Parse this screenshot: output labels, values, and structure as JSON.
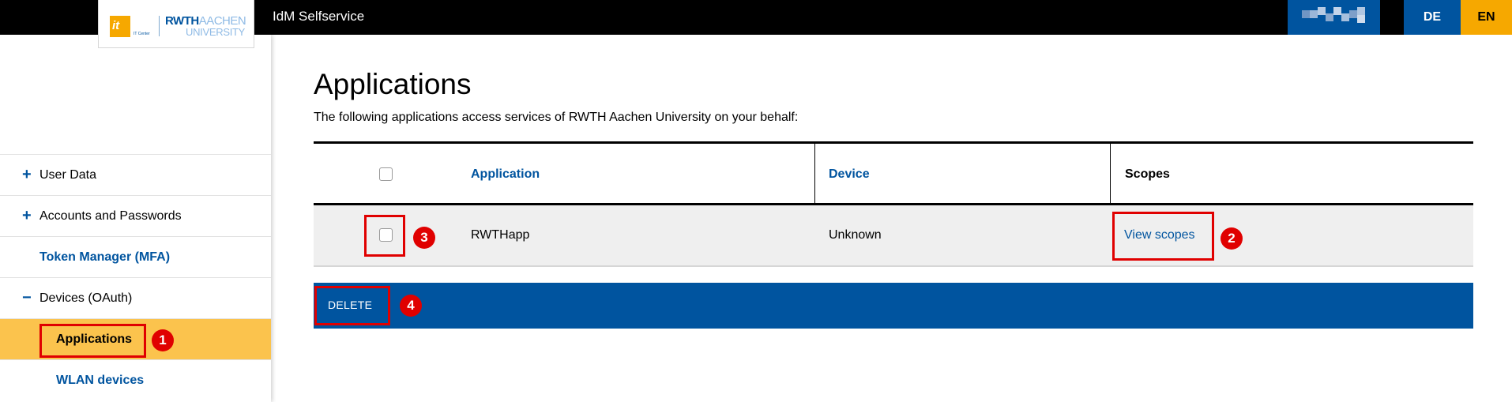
{
  "header": {
    "logo": {
      "itc_letters": "it",
      "itc_caption": "IT Center",
      "rwth_bold": "RWTH",
      "rwth_light": "AACHEN",
      "rwth_line2": "UNIVERSITY"
    },
    "app_title": "IdM Selfservice",
    "languages": [
      "DE",
      "EN"
    ],
    "active_language": "EN"
  },
  "sidebar": {
    "items": [
      {
        "sign": "+",
        "label": "User Data"
      },
      {
        "sign": "+",
        "label": "Accounts and Passwords"
      },
      {
        "sign": "",
        "label": "Token Manager (MFA)"
      },
      {
        "sign": "−",
        "label": "Devices (OAuth)"
      },
      {
        "sign": "",
        "label": "Applications",
        "active": true
      },
      {
        "sign": "",
        "label": "WLAN devices"
      }
    ]
  },
  "main": {
    "title": "Applications",
    "intro": "The following applications access services of RWTH Aachen University on your behalf:",
    "table": {
      "columns": [
        "Application",
        "Device",
        "Scopes"
      ],
      "rows": [
        {
          "application": "RWTHapp",
          "device": "Unknown",
          "scopes_link": "View scopes"
        }
      ]
    },
    "delete_label": "DELETE"
  },
  "annotations": [
    "1",
    "2",
    "3",
    "4"
  ],
  "colors": {
    "brand_blue": "#00549f",
    "accent_yellow": "#f6a800",
    "active_nav": "#fbc34d",
    "annotation_red": "#e00000"
  }
}
